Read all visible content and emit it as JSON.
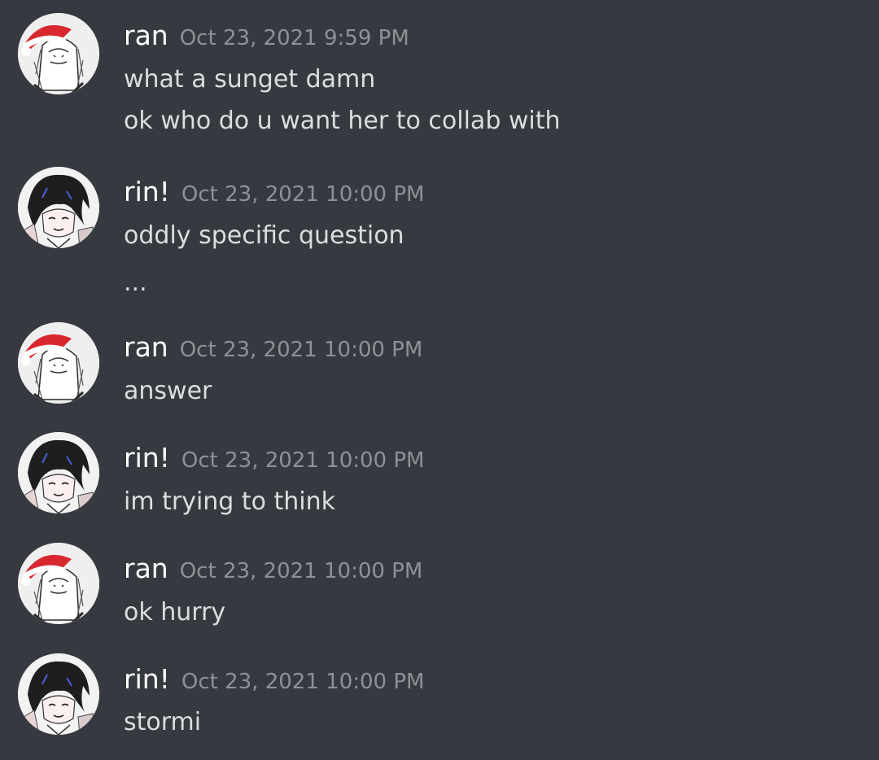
{
  "colors": {
    "background": "#36393f",
    "username": "#ffffff",
    "timestamp": "#8e9297",
    "text": "#dcddde",
    "santa_hat": "#d7282f"
  },
  "messages": [
    {
      "author": "ran",
      "avatar_icon": "santa-hat-avatar-icon",
      "timestamp": "Oct 23, 2021 9:59 PM",
      "lines": [
        "what a sunget damn",
        "ok who do u want her to collab with"
      ]
    },
    {
      "author": "rin!",
      "avatar_icon": "dark-hair-avatar-icon",
      "timestamp": "Oct 23, 2021 10:00 PM",
      "lines": [
        "oddly specific question",
        "..."
      ]
    },
    {
      "author": "ran",
      "avatar_icon": "santa-hat-avatar-icon",
      "timestamp": "Oct 23, 2021 10:00 PM",
      "lines": [
        "answer"
      ]
    },
    {
      "author": "rin!",
      "avatar_icon": "dark-hair-avatar-icon",
      "timestamp": "Oct 23, 2021 10:00 PM",
      "lines": [
        "im trying to think"
      ]
    },
    {
      "author": "ran",
      "avatar_icon": "santa-hat-avatar-icon",
      "timestamp": "Oct 23, 2021 10:00 PM",
      "lines": [
        "ok hurry"
      ]
    },
    {
      "author": "rin!",
      "avatar_icon": "dark-hair-avatar-icon",
      "timestamp": "Oct 23, 2021 10:00 PM",
      "lines": [
        "stormi"
      ]
    }
  ]
}
